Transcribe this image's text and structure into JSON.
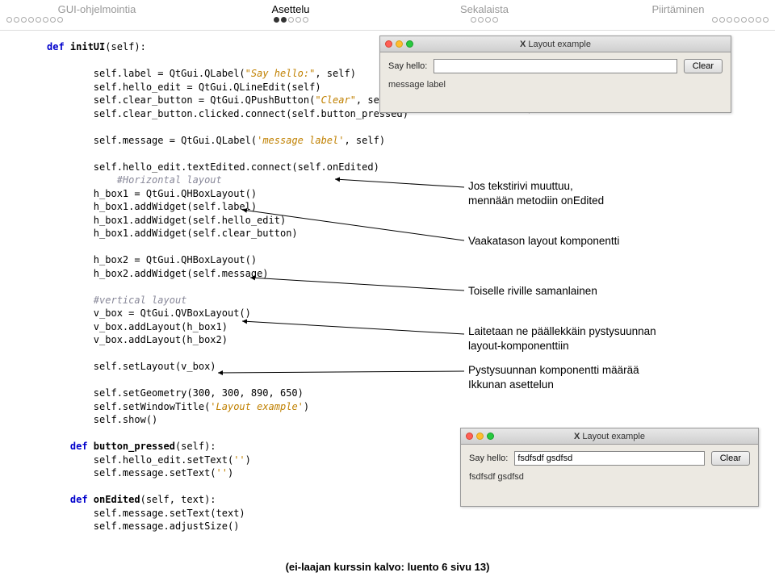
{
  "header": {
    "sections": [
      {
        "label": "GUI-ohjelmointia",
        "dots": 8,
        "active_count": 0
      },
      {
        "label": "Asettelu",
        "dots": 5,
        "active_count": 2,
        "active": true
      },
      {
        "label": "Sekalaista",
        "dots": 4,
        "active_count": 0
      },
      {
        "label": "Piirtäminen",
        "dots": 8,
        "active_count": 0
      }
    ]
  },
  "code": {
    "l1": "def ",
    "l1b": "initUI",
    "l1c": "(self):",
    "l2": "        self.label = QtGui.QLabel(",
    "l2s": "\"Say hello:\"",
    "l2e": ", self)",
    "l3": "        self.hello_edit = QtGui.QLineEdit(self)",
    "l4": "        self.clear_button = QtGui.QPushButton(",
    "l4s": "\"Clear\"",
    "l4e": ", self)",
    "l5": "        self.clear_button.clicked.connect(self.button_pressed)",
    "l6": "        self.message = QtGui.QLabel(",
    "l6s": "'message label'",
    "l6e": ", self)",
    "l7": "        self.hello_edit.textEdited.connect(self.onEdited)",
    "c1": "            #Horizontal layout",
    "l8": "        h_box1 = QtGui.QHBoxLayout()",
    "l9": "        h_box1.addWidget(self.label)",
    "l10": "        h_box1.addWidget(self.hello_edit)",
    "l11": "        h_box1.addWidget(self.clear_button)",
    "l12": "        h_box2 = QtGui.QHBoxLayout()",
    "l13": "        h_box2.addWidget(self.message)",
    "c2": "        #vertical layout",
    "l14": "        v_box = QtGui.QVBoxLayout()",
    "l15": "        v_box.addLayout(h_box1)",
    "l16": "        v_box.addLayout(h_box2)",
    "l17": "        self.setLayout(v_box)",
    "l18": "        self.setGeometry(300, 300, 890, 650)",
    "l19": "        self.setWindowTitle(",
    "l19s": "'Layout example'",
    "l19e": ")",
    "l20": "        self.show()",
    "l21": "    def ",
    "l21b": "button_pressed",
    "l21c": "(self):",
    "l22": "        self.hello_edit.setText(",
    "l22s": "''",
    "l22e": ")",
    "l23": "        self.message.setText(",
    "l23s": "''",
    "l23e": ")",
    "l24": "    def ",
    "l24b": "onEdited",
    "l24c": "(self, text):",
    "l25": "        self.message.setText(text)",
    "l26": "        self.message.adjustSize()"
  },
  "annotations": {
    "a1": "Jos tekstirivi muuttuu,\nmennään metodiin onEdited",
    "a2": "Vaakatason layout komponentti",
    "a3": "Toiselle riville samanlainen",
    "a4": "Laitetaan ne päällekkäin pystysuunnan\nlayout-komponenttiin",
    "a5": "Pystysuunnan komponentti määrää\nIkkunan asettelun"
  },
  "window1": {
    "title": "Layout example",
    "label": "Say hello:",
    "input_value": "",
    "button": "Clear",
    "message": "message label"
  },
  "window2": {
    "title": "Layout example",
    "label": "Say hello:",
    "input_value": "fsdfsdf gsdfsd",
    "button": "Clear",
    "message": "fsdfsdf gsdfsd"
  },
  "footer": "(ei-laajan kurssin kalvo: luento 6 sivu 13)"
}
